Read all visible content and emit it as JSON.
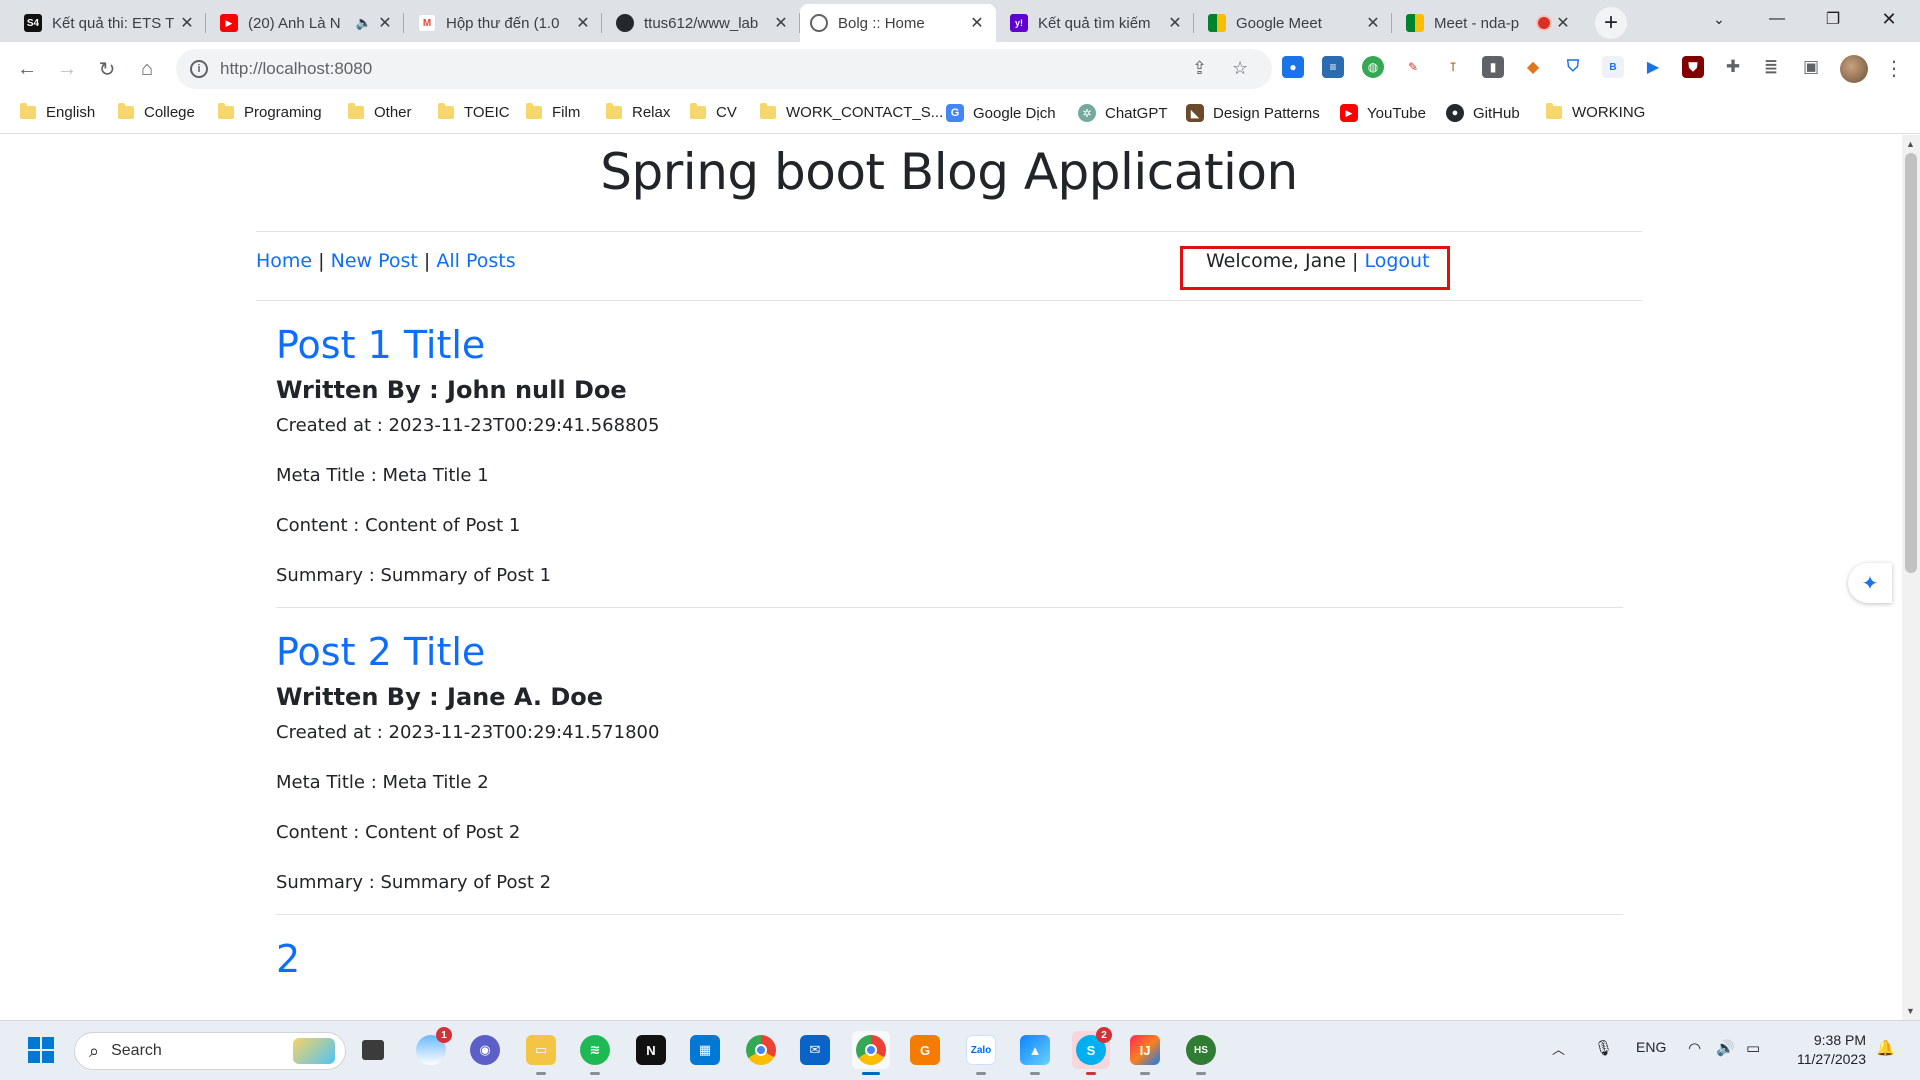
{
  "browser": {
    "tabs": [
      {
        "title": "Kết quả thi: ETS T",
        "icon": "s4-icon",
        "color": "#111111",
        "glyph": "S4"
      },
      {
        "title": "(20) Anh Là N",
        "icon": "youtube-icon",
        "color": "#ff0000",
        "glyph": "▶",
        "muted_audio": "🔈"
      },
      {
        "title": "Hộp thư đến (1.0",
        "icon": "gmail-icon",
        "color": "#ea4335",
        "glyph": "M"
      },
      {
        "title": "ttus612/www_lab",
        "icon": "github-icon",
        "color": "#24292e",
        "glyph": "●"
      },
      {
        "title": "Bolg :: Home",
        "icon": "globe-icon",
        "color": "#5f6368",
        "glyph": "◎"
      },
      {
        "title": "Kết quả tìm kiếm",
        "icon": "yahoo-icon",
        "color": "#6001d2",
        "glyph": "y!"
      },
      {
        "title": "Google Meet",
        "icon": "meet-icon",
        "color": "#00832d",
        "glyph": "▮"
      },
      {
        "title": "Meet - nda-p",
        "icon": "meet-icon",
        "color": "#00832d",
        "glyph": "▮"
      }
    ],
    "active_tab_index": 4,
    "url": "http://localhost:8080",
    "bookmarks": [
      {
        "label": "English",
        "type": "folder"
      },
      {
        "label": "College",
        "type": "folder"
      },
      {
        "label": "Programing",
        "type": "folder"
      },
      {
        "label": "Other",
        "type": "folder"
      },
      {
        "label": "TOEIC",
        "type": "folder"
      },
      {
        "label": "Film",
        "type": "folder"
      },
      {
        "label": "Relax",
        "type": "folder"
      },
      {
        "label": "CV",
        "type": "folder"
      },
      {
        "label": "WORK_CONTACT_S...",
        "type": "folder"
      },
      {
        "label": "Google Dịch",
        "type": "link",
        "icon": "google-translate-icon",
        "color": "#4285f4"
      },
      {
        "label": "ChatGPT",
        "type": "link",
        "icon": "chatgpt-icon",
        "color": "#74aa9c"
      },
      {
        "label": "Design Patterns",
        "type": "link",
        "icon": "refactoring-guru-icon",
        "color": "#6b4b2a"
      },
      {
        "label": "YouTube",
        "type": "link",
        "icon": "youtube-icon",
        "color": "#ff0000"
      },
      {
        "label": "GitHub",
        "type": "link",
        "icon": "github-icon",
        "color": "#24292e"
      },
      {
        "label": "WORKING",
        "type": "folder"
      }
    ]
  },
  "page": {
    "title": "Spring boot Blog Application",
    "nav": {
      "home": "Home",
      "new_post": "New Post",
      "all_posts": "All Posts",
      "separator": "|"
    },
    "auth": {
      "welcome": "Welcome, Jane",
      "logout": "Logout"
    },
    "posts": [
      {
        "title": "Post 1 Title",
        "written_by": "Written By : John null Doe",
        "created_at": "Created at : 2023-11-23T00:29:41.568805",
        "meta_title": "Meta Title : Meta Title 1",
        "content": "Content : Content of Post 1",
        "summary": "Summary : Summary of Post 1"
      },
      {
        "title": "Post 2 Title",
        "written_by": "Written By : Jane A. Doe",
        "created_at": "Created at : 2023-11-23T00:29:41.571800",
        "meta_title": "Meta Title : Meta Title 2",
        "content": "Content : Content of Post 2",
        "summary": "Summary : Summary of Post 2"
      }
    ],
    "pagination": "2"
  },
  "taskbar": {
    "search_placeholder": "Search",
    "weather_badge": "1",
    "skype_badge": "2",
    "language": "ENG",
    "time": "9:38 PM",
    "date": "11/27/2023"
  },
  "colors": {
    "link": "#0d6efd",
    "highlight_border": "#e01010",
    "text": "#212529"
  }
}
